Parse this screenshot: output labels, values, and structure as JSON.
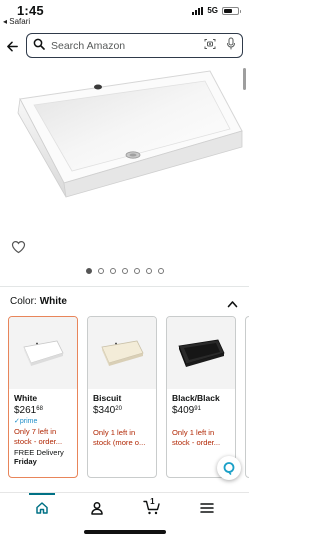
{
  "status": {
    "time": "1:45",
    "back_app": "◂ Safari",
    "network": "5G"
  },
  "search": {
    "placeholder": "Search Amazon"
  },
  "gallery": {
    "dot_count": 7,
    "active_index": 0
  },
  "color": {
    "label": "Color:",
    "value": "White"
  },
  "variants": [
    {
      "name": "White",
      "price_whole": "$261",
      "price_cents": "68",
      "prime": "✓prime",
      "stock": "Only 7 left in stock - order...",
      "delivery": "FREE Delivery",
      "day": "Friday",
      "swatch_color": "#f4f4f4",
      "selected": true
    },
    {
      "name": "Biscuit",
      "price_whole": "$340",
      "price_cents": "20",
      "stock": "Only 1 left in stock (more o...",
      "swatch_color": "#f0ead6",
      "selected": false
    },
    {
      "name": "Black/Black",
      "price_whole": "$409",
      "price_cents": "91",
      "stock": "Only 1 left in stock - order...",
      "swatch_color": "#1c1c1c",
      "selected": false
    }
  ],
  "nav": {
    "cart_count": "1",
    "accent": "#007185"
  }
}
